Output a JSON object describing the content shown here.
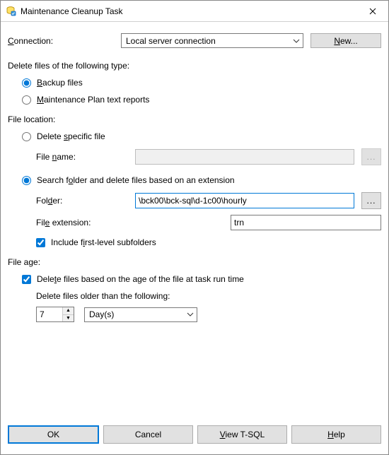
{
  "window": {
    "title": "Maintenance Cleanup Task"
  },
  "connection": {
    "label": "Connection:",
    "value": "Local server connection",
    "new_button": "New..."
  },
  "fileType": {
    "heading": "Delete files of the following type:",
    "backup": "Backup files",
    "reports": "Maintenance Plan text reports",
    "selected": "backup"
  },
  "fileLocation": {
    "heading": "File location:",
    "specific": "Delete specific file",
    "fileNameLabel": "File name:",
    "fileNameValue": "",
    "search": "Search folder and delete files based on an extension",
    "folderLabel": "Folder:",
    "folderValue": "\\bck00\\bck-sql\\d-1c00\\hourly",
    "extLabel": "File extension:",
    "extValue": "trn",
    "includeSub": "Include first-level subfolders",
    "includeSubChecked": true,
    "selected": "search"
  },
  "fileAge": {
    "heading": "File age:",
    "deleteByAge": "Delete files based on the age of the file at task run time",
    "deleteByAgeChecked": true,
    "olderThan": "Delete files older than the following:",
    "value": "7",
    "unit": "Day(s)"
  },
  "buttons": {
    "ok": "OK",
    "cancel": "Cancel",
    "viewTsql": "View T-SQL",
    "help": "Help"
  },
  "ellipsis": "..."
}
